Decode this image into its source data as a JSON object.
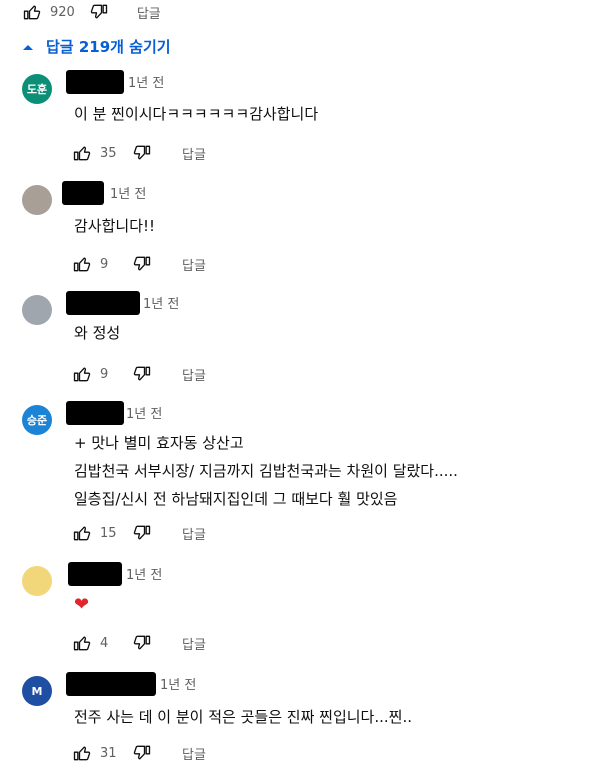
{
  "top_comment": {
    "likes": "920",
    "reply_label": "답글"
  },
  "replies_toggle": {
    "label": "답글 219개 숨기기",
    "icon": "chevron-up-icon"
  },
  "comments": [
    {
      "avatar_text": "도훈",
      "avatar_color": "#0b8f76",
      "time": "1년 전",
      "lines": [
        "이 분 찐이시다ㅋㅋㅋㅋㅋㅋ감사합니다"
      ],
      "likes": "35",
      "reply_label": "답글"
    },
    {
      "avatar_text": "",
      "avatar_color": "#a8a096",
      "time": "1년 전",
      "lines": [
        "감사합니다!!"
      ],
      "likes": "9",
      "reply_label": "답글"
    },
    {
      "avatar_text": "",
      "avatar_color": "#9fa6ad",
      "time": "1년 전",
      "lines": [
        "와 정성"
      ],
      "likes": "9",
      "reply_label": "답글"
    },
    {
      "avatar_text": "승준",
      "avatar_color": "#1b84d6",
      "time": "1년 전",
      "lines": [
        "+ 맛나 별미 효자동 상산고",
        "김밥천국 서부시장/ 지금까지 김밥천국과는 차원이 달랐다.....",
        "일층집/신시 전 하남돼지집인데 그 때보다 훨 맛있음"
      ],
      "likes": "15",
      "reply_label": "답글"
    },
    {
      "avatar_text": "",
      "avatar_color": "#f1d77a",
      "time": "1년 전",
      "lines": [
        "❤"
      ],
      "likes": "4",
      "reply_label": "답글"
    },
    {
      "avatar_text": "M",
      "avatar_color": "#1f4fa3",
      "time": "1년 전",
      "lines": [
        "전주 사는 데 이 분이 적은 곳들은 진짜 찐입니다...찐.."
      ],
      "likes": "31",
      "reply_label": "답글"
    }
  ],
  "icons": {
    "like": "thumbs-up-icon",
    "dislike": "thumbs-down-icon"
  }
}
